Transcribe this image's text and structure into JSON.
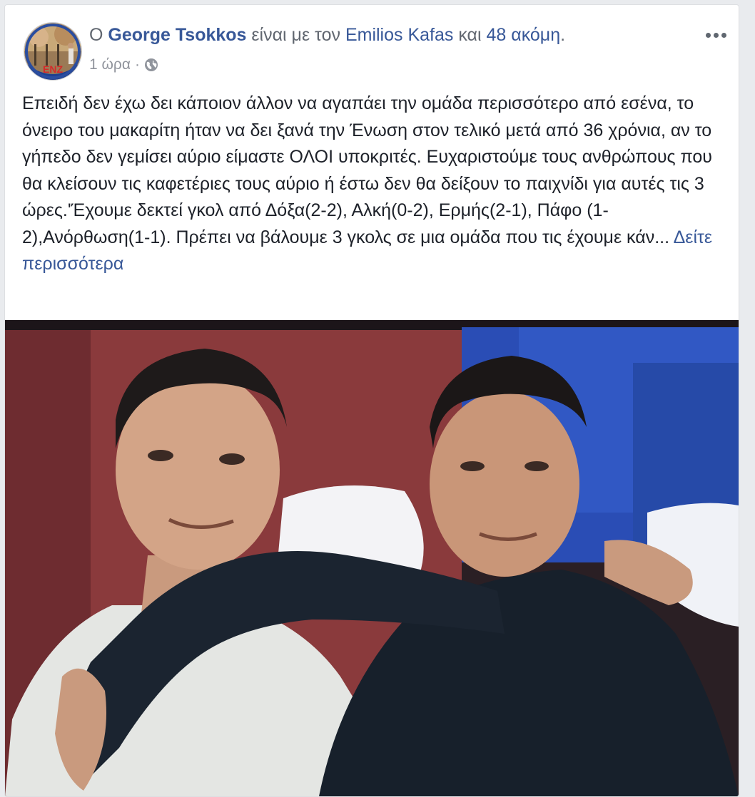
{
  "post": {
    "header": {
      "prefix": "Ο",
      "author": "George Tsokkos",
      "middle": "είναι με τον",
      "tagged": "Emilios Kafas",
      "conjunction": "και",
      "others": "48 ακόμη",
      "suffix": "."
    },
    "timestamp": "1 ώρα",
    "separator": "·",
    "privacy_icon": "globe-icon",
    "menu_icon": "more-options-icon",
    "text": "Επειδή δεν έχω δει κάποιον άλλον να αγαπάει την ομάδα περισσότερο από εσένα, το όνειρο του μακαρίτη ήταν να δει ξανά την Ένωση στον τελικό μετά από 36 χρόνια, αν το γήπεδο δεν γεμίσει αύριο είμαστε ΟΛΟΙ υποκριτές. Ευχαριστούμε τους ανθρώπους που θα κλείσουν τις καφετέριες τους αύριο ή έστω δεν θα δείξουν το παιχνίδι για αυτές τις 3 ώρες.'Έχουμε δεκτεί γκολ από Δόξα(2-2), Αλκή(0-2), Ερμής(2-1), Πάφο (1-2),Ανόρθωση(1-1). Πρέπει να βάλουμε 3 γκολς σε μια ομάδα που τις έχουμε κάν...",
    "see_more": "Δείτε περισσότερα",
    "avatar_logo_text": "ENZ"
  },
  "colors": {
    "link": "#385898",
    "text": "#1d2129",
    "meta": "#90949c",
    "background": "#e9ebee",
    "card": "#ffffff"
  }
}
